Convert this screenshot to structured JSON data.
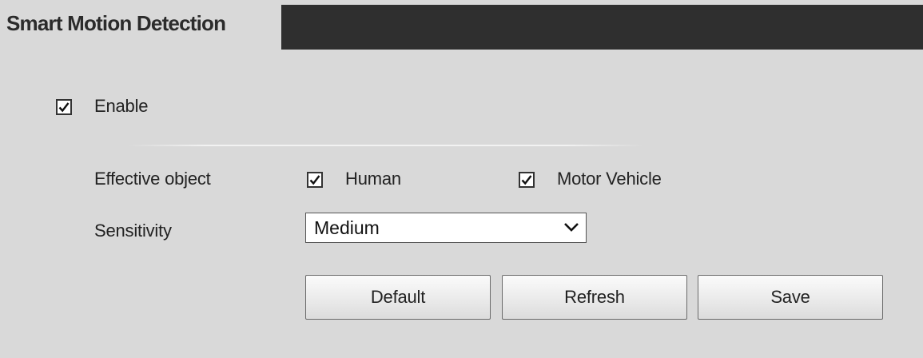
{
  "header": {
    "title": "Smart Motion Detection"
  },
  "form": {
    "enable": {
      "label": "Enable",
      "checked": true
    },
    "effective_object": {
      "label": "Effective object",
      "options": [
        {
          "label": "Human",
          "checked": true
        },
        {
          "label": "Motor Vehicle",
          "checked": true
        }
      ]
    },
    "sensitivity": {
      "label": "Sensitivity",
      "value": "Medium"
    }
  },
  "buttons": {
    "default": "Default",
    "refresh": "Refresh",
    "save": "Save"
  },
  "colors": {
    "background": "#d9d9d9",
    "title_bar": "#2f2f2f"
  }
}
